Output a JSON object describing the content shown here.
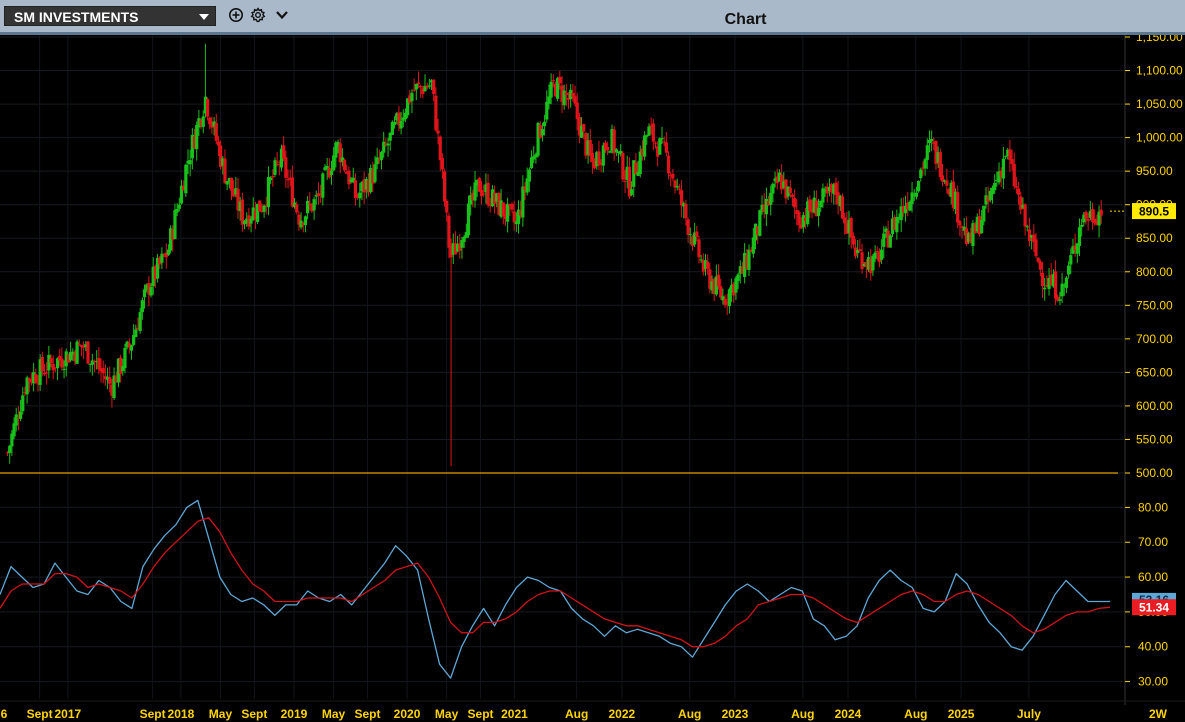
{
  "toolbar": {
    "symbol_label": "SM INVESTMENTS",
    "add_icon": "add-circle-icon",
    "settings_icon": "gear-icon",
    "menu_icon": "chevron-down-icon",
    "title": "Chart"
  },
  "colors": {
    "up": "#19c21a",
    "down": "#e0141a",
    "rsi": "#5ea7d6",
    "rsi_signal": "#d01418",
    "axis_text": "#ffd400",
    "price_tag_bg": "#ffea00",
    "rsi_tag_bg": "#ea1d24",
    "rsi_tag_alt_bg": "#5ea7d6",
    "divider": "#e5a000"
  },
  "chart_data": [
    {
      "type": "candlestick",
      "period": "weekly",
      "ylim": [
        500,
        1150
      ],
      "yticks": [
        "500.00",
        "550.00",
        "600.00",
        "650.00",
        "700.00",
        "750.00",
        "800.00",
        "850.00",
        "900.00",
        "950.00",
        "1,000.00",
        "1,050.00",
        "1,100.00",
        "1,150.00"
      ],
      "last_price_label": "890.5",
      "x_tick_labels": [
        "6",
        "Sept",
        "2017",
        "Sept",
        "2018",
        "May",
        "Sept",
        "2019",
        "May",
        "Sept",
        "2020",
        "May",
        "Sept",
        "2021",
        "Aug",
        "2022",
        "Aug",
        "2023",
        "Aug",
        "2024",
        "Aug",
        "2025",
        "July",
        "2W"
      ],
      "close_path": [
        [
          "2016-09",
          530
        ],
        [
          "2016-11",
          640
        ],
        [
          "2017-02",
          665
        ],
        [
          "2017-05",
          690
        ],
        [
          "2017-08",
          630
        ],
        [
          "2017-10",
          690
        ],
        [
          "2017-12",
          780
        ],
        [
          "2018-02",
          830
        ],
        [
          "2018-04",
          960
        ],
        [
          "2018-06",
          1060
        ],
        [
          "2018-08",
          950
        ],
        [
          "2018-10",
          880
        ],
        [
          "2018-12",
          900
        ],
        [
          "2019-02",
          970
        ],
        [
          "2019-04",
          880
        ],
        [
          "2019-06",
          910
        ],
        [
          "2019-08",
          990
        ],
        [
          "2019-10",
          910
        ],
        [
          "2019-12",
          950
        ],
        [
          "2020-02",
          1010
        ],
        [
          "2020-04",
          1070
        ],
        [
          "2020-06",
          1080
        ],
        [
          "2020-07",
          960
        ],
        [
          "2020-08",
          820
        ],
        [
          "2020-09",
          850
        ],
        [
          "2020-11",
          930
        ],
        [
          "2021-01",
          900
        ],
        [
          "2021-03",
          870
        ],
        [
          "2021-05",
          990
        ],
        [
          "2021-07",
          1080
        ],
        [
          "2021-09",
          1050
        ],
        [
          "2021-11",
          960
        ],
        [
          "2022-01",
          1000
        ],
        [
          "2022-03",
          930
        ],
        [
          "2022-05",
          1010
        ],
        [
          "2022-07",
          970
        ],
        [
          "2022-09",
          880
        ],
        [
          "2022-11",
          800
        ],
        [
          "2023-01",
          760
        ],
        [
          "2023-03",
          800
        ],
        [
          "2023-05",
          880
        ],
        [
          "2023-07",
          940
        ],
        [
          "2023-09",
          880
        ],
        [
          "2023-11",
          900
        ],
        [
          "2024-01",
          920
        ],
        [
          "2024-03",
          830
        ],
        [
          "2024-05",
          810
        ],
        [
          "2024-07",
          870
        ],
        [
          "2024-09",
          920
        ],
        [
          "2024-11",
          990
        ],
        [
          "2025-01",
          930
        ],
        [
          "2025-03",
          840
        ],
        [
          "2025-05",
          900
        ],
        [
          "2025-07",
          980
        ],
        [
          "2025-09",
          870
        ],
        [
          "2025-11",
          790
        ],
        [
          "2026-01",
          770
        ],
        [
          "2026-03",
          880
        ],
        [
          "2026-05",
          890.5
        ]
      ],
      "notable_wicks": [
        {
          "x": "2018-06",
          "high": 1140
        },
        {
          "x": "2020-08",
          "low": 510
        }
      ]
    },
    {
      "type": "line",
      "indicator": "RSI",
      "ylim": [
        25,
        87
      ],
      "yticks": [
        "30.00",
        "40.00",
        "50.00",
        "60.00",
        "70.00",
        "80.00"
      ],
      "rsi_label": "53.16",
      "signal_label": "51.34",
      "series": [
        {
          "name": "",
          "role": "rsi",
          "values": [
            55,
            63,
            60,
            57,
            58,
            64,
            60,
            56,
            55,
            59,
            57,
            53,
            51,
            63,
            68,
            72,
            75,
            80,
            82,
            71,
            60,
            55,
            53,
            54,
            52,
            49,
            52,
            52,
            56,
            54,
            53,
            55,
            52,
            56,
            60,
            64,
            69,
            66,
            62,
            48,
            35,
            31,
            40,
            46,
            51,
            46,
            52,
            57,
            60,
            59,
            57,
            56,
            51,
            48,
            46,
            43,
            46,
            44,
            45,
            44,
            43,
            41,
            40,
            37,
            42,
            47,
            52,
            56,
            58,
            56,
            53,
            55,
            57,
            56,
            48,
            46,
            42,
            43,
            46,
            54,
            59,
            62,
            59,
            57,
            51,
            50,
            53,
            61,
            58,
            52,
            47,
            44,
            40,
            39,
            43,
            49,
            55,
            59,
            56,
            53,
            53,
            53
          ]
        },
        {
          "name": "",
          "role": "signal",
          "values": [
            51,
            56,
            58,
            58,
            58,
            61,
            61,
            60,
            57,
            58,
            57,
            56,
            54,
            58,
            63,
            67,
            70,
            73,
            76,
            77,
            73,
            67,
            62,
            58,
            56,
            53,
            53,
            53,
            54,
            54,
            54,
            54,
            53,
            55,
            57,
            59,
            62,
            63,
            64,
            60,
            54,
            47,
            44,
            44,
            47,
            47,
            48,
            50,
            53,
            55,
            56,
            56,
            54,
            52,
            50,
            48,
            47,
            46,
            46,
            45,
            44,
            43,
            42,
            40,
            40,
            41,
            43,
            46,
            48,
            52,
            53,
            54,
            55,
            55,
            54,
            52,
            50,
            48,
            47,
            49,
            51,
            53,
            55,
            56,
            55,
            53,
            53,
            55,
            56,
            55,
            53,
            51,
            49,
            46,
            44,
            45,
            47,
            49,
            50,
            50,
            51,
            51.34
          ]
        }
      ]
    }
  ]
}
